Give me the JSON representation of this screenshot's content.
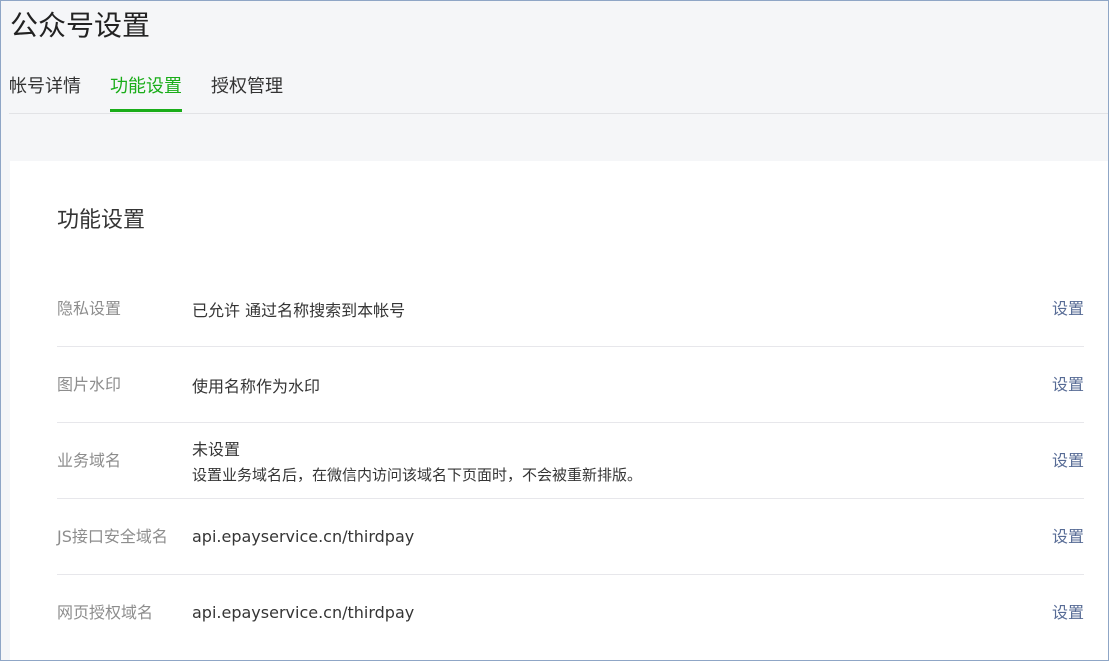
{
  "header": {
    "title": "公众号设置"
  },
  "tabs": [
    {
      "label": "帐号详情",
      "active": false
    },
    {
      "label": "功能设置",
      "active": true
    },
    {
      "label": "授权管理",
      "active": false
    }
  ],
  "section": {
    "title": "功能设置",
    "rows": [
      {
        "label": "隐私设置",
        "value": "已允许 通过名称搜索到本帐号",
        "value2": "",
        "action": "设置"
      },
      {
        "label": "图片水印",
        "value": "使用名称作为水印",
        "value2": "",
        "action": "设置"
      },
      {
        "label": "业务域名",
        "value": "未设置",
        "value2": "设置业务域名后，在微信内访问该域名下页面时，不会被重新排版。",
        "action": "设置"
      },
      {
        "label": "JS接口安全域名",
        "value": "api.epayservice.cn/thirdpay",
        "value2": "",
        "action": "设置"
      },
      {
        "label": "网页授权域名",
        "value": "api.epayservice.cn/thirdpay",
        "value2": "",
        "action": "设置"
      }
    ]
  },
  "colors": {
    "accent": "#1aad19",
    "link": "#576b95",
    "label": "#8d8d8d"
  }
}
